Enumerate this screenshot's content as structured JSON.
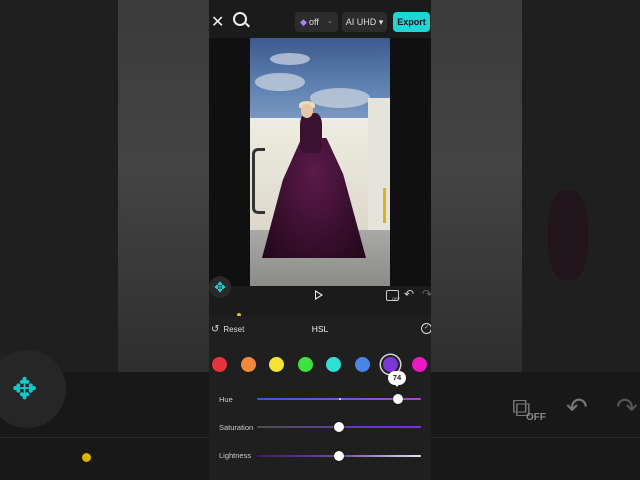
{
  "topbar": {
    "quality_toggle_label": "off",
    "quality_toggle_caret": "⌄",
    "ai_uhd_label": "AI UHD ▾",
    "export_label": "Export"
  },
  "player": {
    "off_badge": "OFF"
  },
  "background": {
    "off_badge": "OFF"
  },
  "panel": {
    "reset_label": "Reset",
    "title": "HSL",
    "swatches": [
      {
        "name": "red",
        "color": "#e8323c",
        "selected": false
      },
      {
        "name": "orange",
        "color": "#f08a3a",
        "selected": false
      },
      {
        "name": "yellow",
        "color": "#f2e334",
        "selected": false
      },
      {
        "name": "green",
        "color": "#3fe03f",
        "selected": false
      },
      {
        "name": "cyan",
        "color": "#2fe0d6",
        "selected": false
      },
      {
        "name": "blue",
        "color": "#4a86e8",
        "selected": false
      },
      {
        "name": "purple",
        "color": "#7b38d8",
        "selected": true
      },
      {
        "name": "magenta",
        "color": "#ea19c4",
        "selected": false
      }
    ],
    "sliders": {
      "hue": {
        "label": "Hue",
        "value": 74,
        "tooltip": "74"
      },
      "saturation": {
        "label": "Saturation",
        "value": 0
      },
      "lightness": {
        "label": "Lightness",
        "value": 0
      }
    }
  },
  "colors": {
    "accent": "#1fd6d6",
    "progress_marker": "#e1c21b"
  }
}
